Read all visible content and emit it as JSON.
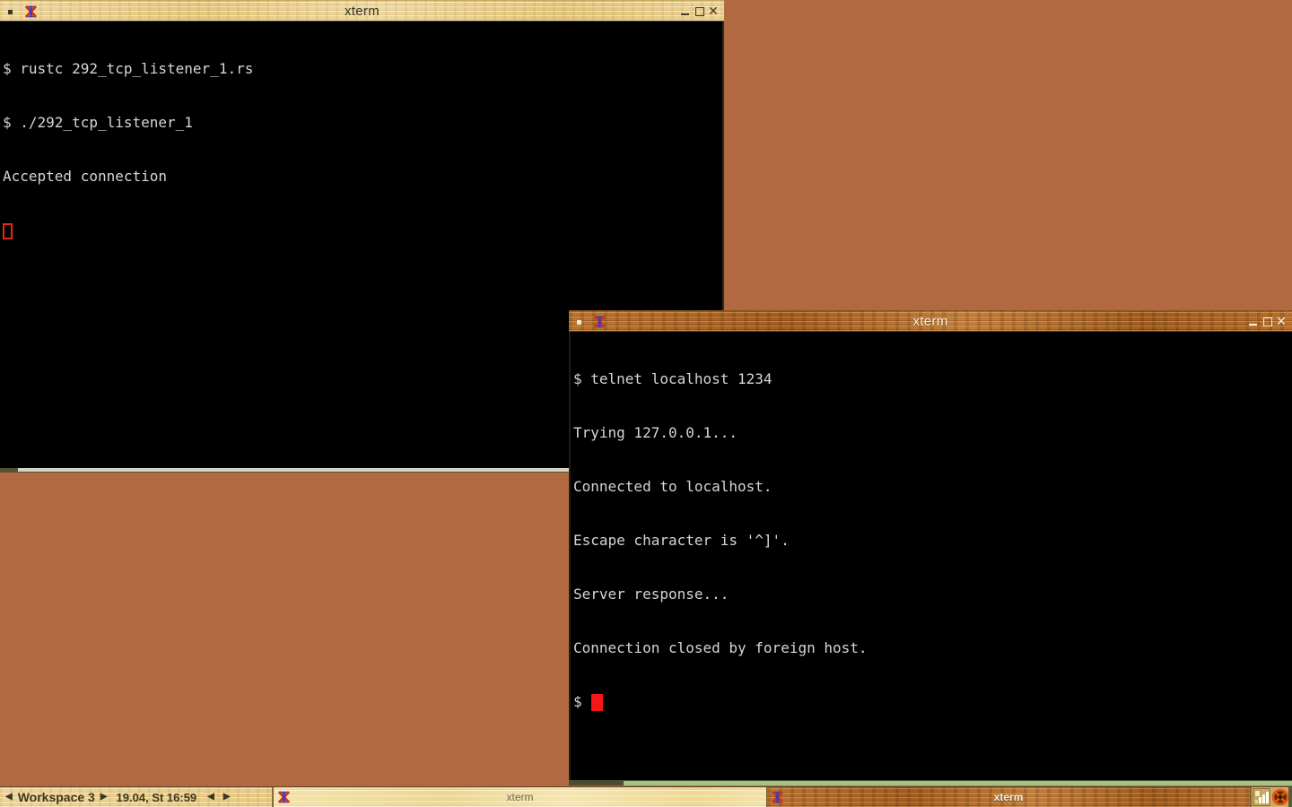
{
  "window1": {
    "title": "xterm",
    "focused": false,
    "lines": [
      "$ rustc 292_tcp_listener_1.rs",
      "$ ./292_tcp_listener_1",
      "Accepted connection"
    ],
    "cursor_style": "hollow"
  },
  "window2": {
    "title": "xterm",
    "focused": true,
    "lines": [
      "$ telnet localhost 1234",
      "Trying 127.0.0.1...",
      "Connected to localhost.",
      "Escape character is '^]'.",
      "Server response...",
      "Connection closed by foreign host."
    ],
    "prompt": "$",
    "cursor_style": "solid"
  },
  "window_controls": {
    "minimize": "minimize",
    "maximize": "maximize",
    "close": "✕"
  },
  "taskbar": {
    "arrow_left": "◀",
    "arrow_right": "▶",
    "workspace_label": "Workspace 3",
    "clock": "19.04, St 16:59",
    "tasks": [
      {
        "label": "xterm",
        "active": false
      },
      {
        "label": "xterm",
        "active": true
      }
    ],
    "tray_icons": [
      "net-monitor-icon",
      "wheel-mute-icon"
    ]
  },
  "icons": {
    "xterm_logo": "xterm-x-logo",
    "menu_dot": "window-menu-square"
  },
  "colors": {
    "desktop_bg": "#b06941",
    "terminal_bg": "#000000",
    "terminal_fg": "#d6d6d6",
    "cursor_red": "#f51616",
    "titlebar_unfocused_wood": "#ecd08d",
    "titlebar_focused_wood": "#b06a27",
    "taskbar_wood": "#ecd08d",
    "window2_bottom_border_green": "#a3c285",
    "window1_bottom_border_gray": "#d3d3c7"
  }
}
